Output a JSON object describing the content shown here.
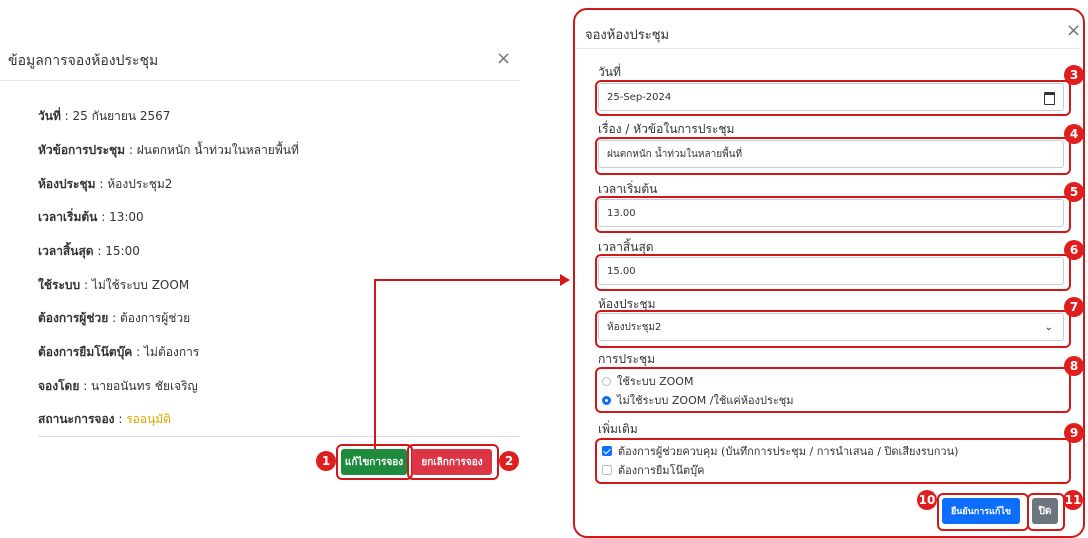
{
  "left_modal": {
    "title": "ข้อมูลการจองห้องประชุม",
    "close_icon": "×",
    "rows": [
      {
        "label": "วันที่",
        "value": " : 25 กันยายน 2567"
      },
      {
        "label": "หัวข้อการประชุม",
        "value": " : ฝนตกหนัก น้ำท่วมในหลายพื้นที่"
      },
      {
        "label": "ห้องประชุม",
        "value": " : ห้องประชุม2"
      },
      {
        "label": "เวลาเริ่มต้น",
        "value": " : 13:00"
      },
      {
        "label": "เวลาสิ้นสุด",
        "value": " : 15:00"
      },
      {
        "label": "ใช้ระบบ",
        "value": " : ไม่ใช้ระบบ ZOOM"
      },
      {
        "label": "ต้องการผู้ช่วย",
        "value": " : ต้องการผู้ช่วย"
      },
      {
        "label": "ต้องการยืมโน๊ตบุ๊ค",
        "value": " : ไม่ต้องการ"
      },
      {
        "label": "จองโดย",
        "value": " : นายอนันทร ชัยเจริญ"
      },
      {
        "label": "สถานะการจอง",
        "value": " : ",
        "status": "รออนุมัติ"
      }
    ],
    "edit_button": "แก้ไขการจอง",
    "cancel_button": "ยกเลิกการจอง"
  },
  "right_modal": {
    "title": "จองห้องประชุม",
    "close_icon": "×",
    "date_label": "วันที่",
    "date_value": "25-Sep-2024",
    "topic_label": "เรื่อง / หัวข้อในการประชุม",
    "topic_value": "ฝนตกหนัก น้ำท่วมในหลายพื้นที่",
    "start_label": "เวลาเริ่มต้น",
    "start_value": "13.00",
    "end_label": "เวลาสิ้นสุด",
    "end_value": "15.00",
    "room_label": "ห้องประชุม",
    "room_value": "ห้องประชุม2",
    "meeting_label": "การประชุม",
    "meeting_options": [
      "ใช้ระบบ ZOOM",
      "ไม่ใช้ระบบ ZOOM /ใช้แค่ห้องประชุม"
    ],
    "meeting_selected": 1,
    "extra_label": "เพิ่มเติม",
    "extra_options": [
      "ต้องการผู้ช่วยควบคุม (บันทึกการประชุม / การนำเสนอ / ปิดเสียงรบกวน)",
      "ต้องการยืมโน๊ตบุ๊ค"
    ],
    "extra_checked": [
      true,
      false
    ],
    "confirm_button": "ยืนยันการแก้ไข",
    "close_button": "ปิด"
  },
  "markers": [
    "1",
    "2",
    "3",
    "4",
    "5",
    "6",
    "7",
    "8",
    "9",
    "10",
    "11"
  ],
  "colors": {
    "highlight": "#d01818",
    "primary": "#0d6efd",
    "success": "#1e8a3e",
    "danger": "#dc3545",
    "warning": "#e0a800"
  }
}
